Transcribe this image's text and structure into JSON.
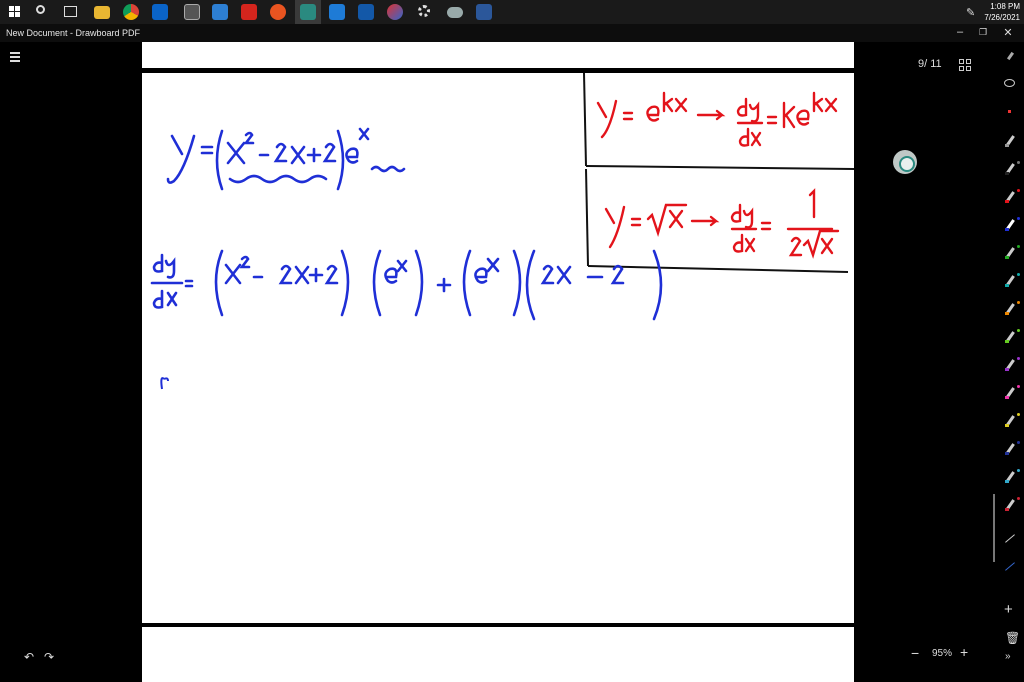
{
  "window": {
    "title": "New Document - Drawboard PDF",
    "controls": [
      "–",
      "❐",
      "✕"
    ]
  },
  "taskbar": {
    "time": "1:08 PM",
    "date": "7/26/2021",
    "apps": [
      "start",
      "search",
      "task-view",
      "file-explorer",
      "chrome",
      "outlook",
      "calculator",
      "snipping-tool",
      "acrobat",
      "ubuntu",
      "drawboard",
      "camera",
      "whiteboard",
      "paint",
      "settings",
      "onedrive",
      "word"
    ]
  },
  "viewer": {
    "page_indicator": "9/ 11",
    "zoom": "95%",
    "zoom_minus": "−",
    "zoom_plus": "+",
    "undo": "↶",
    "redo": "↷"
  },
  "notes": {
    "function": "y = (x² − 2x + 2)eˣ",
    "derivative": "dy/dx = (x² − 2x + 2)(eˣ) + (eˣ)(2x − 2",
    "rule_exp": "y = eᵏˣ → dy/dx = keᵏˣ",
    "rule_sqrt": "y = √x → dy/dx = 1/(2√x)"
  },
  "rail": {
    "add": "+",
    "trash": "🗑",
    "collapse": "»"
  },
  "colors": {
    "ink_blue": "#1f2fd6",
    "ink_red": "#e3141b"
  }
}
